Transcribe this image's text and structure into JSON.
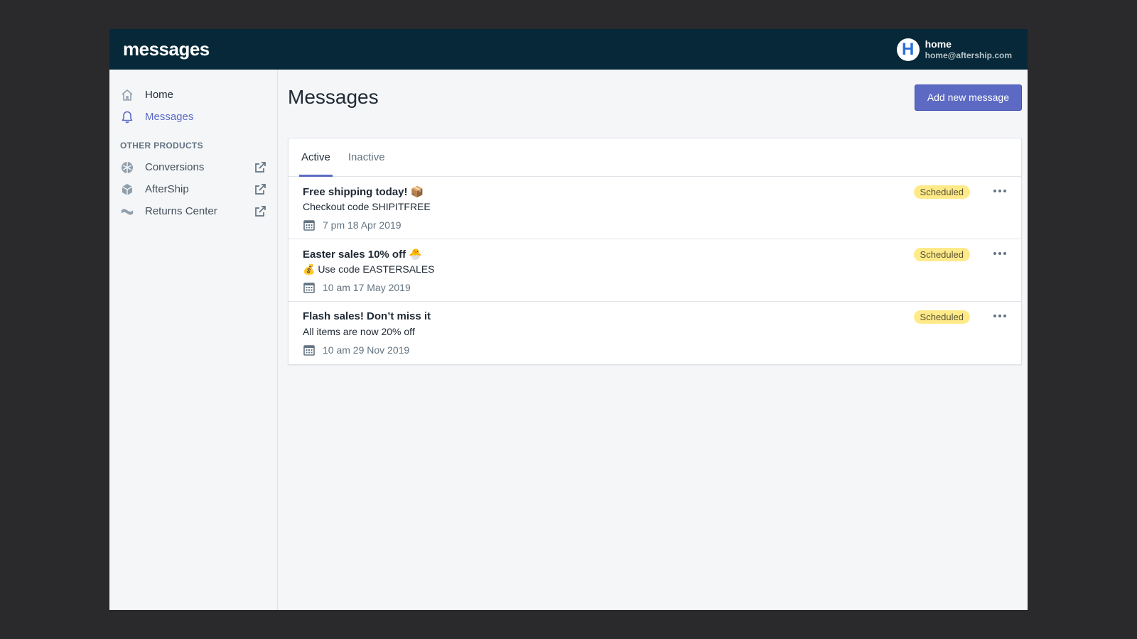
{
  "app": {
    "logo": "messages"
  },
  "user": {
    "initial": "H",
    "name": "home",
    "email": "home@aftership.com"
  },
  "sidebar": {
    "items": [
      {
        "label": "Home",
        "icon": "home-icon"
      },
      {
        "label": "Messages",
        "icon": "bell-icon",
        "active": true
      }
    ],
    "section_title": "OTHER PRODUCTS",
    "products": [
      {
        "label": "Conversions",
        "icon": "conversions-icon"
      },
      {
        "label": "AfterShip",
        "icon": "aftership-icon"
      },
      {
        "label": "Returns Center",
        "icon": "returns-icon"
      }
    ]
  },
  "main": {
    "title": "Messages",
    "add_button": "Add new message",
    "tabs": [
      {
        "label": "Active",
        "active": true
      },
      {
        "label": "Inactive"
      }
    ],
    "messages": [
      {
        "title": "Free shipping today! 📦",
        "subtitle": "Checkout code SHIPITFREE",
        "date": "7 pm 18 Apr 2019",
        "status": "Scheduled"
      },
      {
        "title": "Easter sales 10% off 🐣",
        "subtitle": "💰 Use code EASTERSALES",
        "date": "10 am 17 May 2019",
        "status": "Scheduled"
      },
      {
        "title": "Flash sales! Don’t miss it",
        "subtitle": "All items are now 20% off",
        "date": "10 am 29 Nov 2019",
        "status": "Scheduled"
      }
    ]
  },
  "colors": {
    "topbar": "#062838",
    "accent": "#5c6ac4",
    "badge_bg": "#ffea8a",
    "background": "#f4f6f8"
  }
}
